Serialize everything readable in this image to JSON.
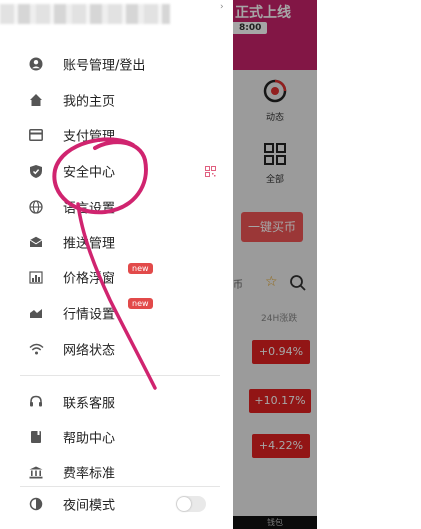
{
  "background_app": {
    "banner_title": "正式上线",
    "banner_time": "8:00",
    "tile_dongtai": "动态",
    "tile_all": "全部",
    "buy_button": "一键买币",
    "tab_label": "币",
    "col_header": "24H涨跌",
    "pct_rows": [
      "+0.94%",
      "+10.17%",
      "+4.22%"
    ],
    "bottom_tab": "钱包"
  },
  "drawer": {
    "items": [
      {
        "label": "账号管理/登出",
        "icon": "person-icon"
      },
      {
        "label": "我的主页",
        "icon": "home-icon"
      },
      {
        "label": "支付管理",
        "icon": "card-icon"
      },
      {
        "label": "安全中心",
        "icon": "shield-icon"
      },
      {
        "label": "语言设置",
        "icon": "globe-icon"
      },
      {
        "label": "推送管理",
        "icon": "mail-icon"
      },
      {
        "label": "价格浮窗",
        "icon": "chart-icon",
        "badge": "new"
      },
      {
        "label": "行情设置",
        "icon": "trend-icon",
        "badge": "new"
      },
      {
        "label": "网络状态",
        "icon": "wifi-icon"
      },
      {
        "label": "联系客服",
        "icon": "headset-icon"
      },
      {
        "label": "帮助中心",
        "icon": "book-icon"
      },
      {
        "label": "费率标准",
        "icon": "bank-icon"
      },
      {
        "label": "夜间模式",
        "icon": "moon-icon"
      }
    ],
    "night_mode_on": false
  },
  "colors": {
    "banner": "#c8226a",
    "accent_red": "#e02121",
    "badge_red": "#e24a4a",
    "annotation_pink": "#d0246f"
  }
}
